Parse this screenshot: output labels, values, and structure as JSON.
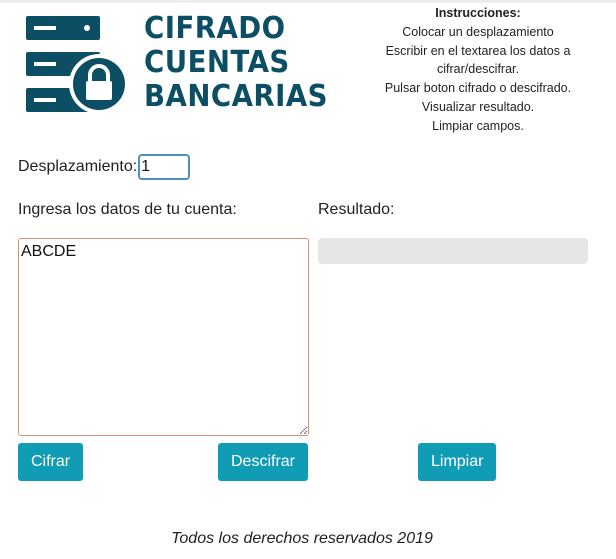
{
  "logo": {
    "lines": [
      "CIFRADO",
      "CUENTAS",
      "BANCARIAS"
    ],
    "brand_color": "#0c4e64",
    "icon": "server-lock-icon"
  },
  "instructions": {
    "title": "Instrucciones:",
    "lines": [
      "Colocar un desplazamiento",
      "Escribir en el textarea los datos a",
      "cifrar/descifrar.",
      "Pulsar boton cifrado o descifrado.",
      "Visualizar resultado.",
      "Limpiar campos."
    ]
  },
  "shift": {
    "label": "Desplazamiento:",
    "value": "1"
  },
  "input": {
    "label": "Ingresa los datos de tu cuenta:",
    "value": "ABCDE"
  },
  "result": {
    "label": "Resultado:",
    "value": ""
  },
  "buttons": {
    "encrypt": "Cifrar",
    "decrypt": "Descifrar",
    "clear": "Limpiar",
    "color": "#119cb5"
  },
  "footer": "Todos los derechos reservados 2019"
}
